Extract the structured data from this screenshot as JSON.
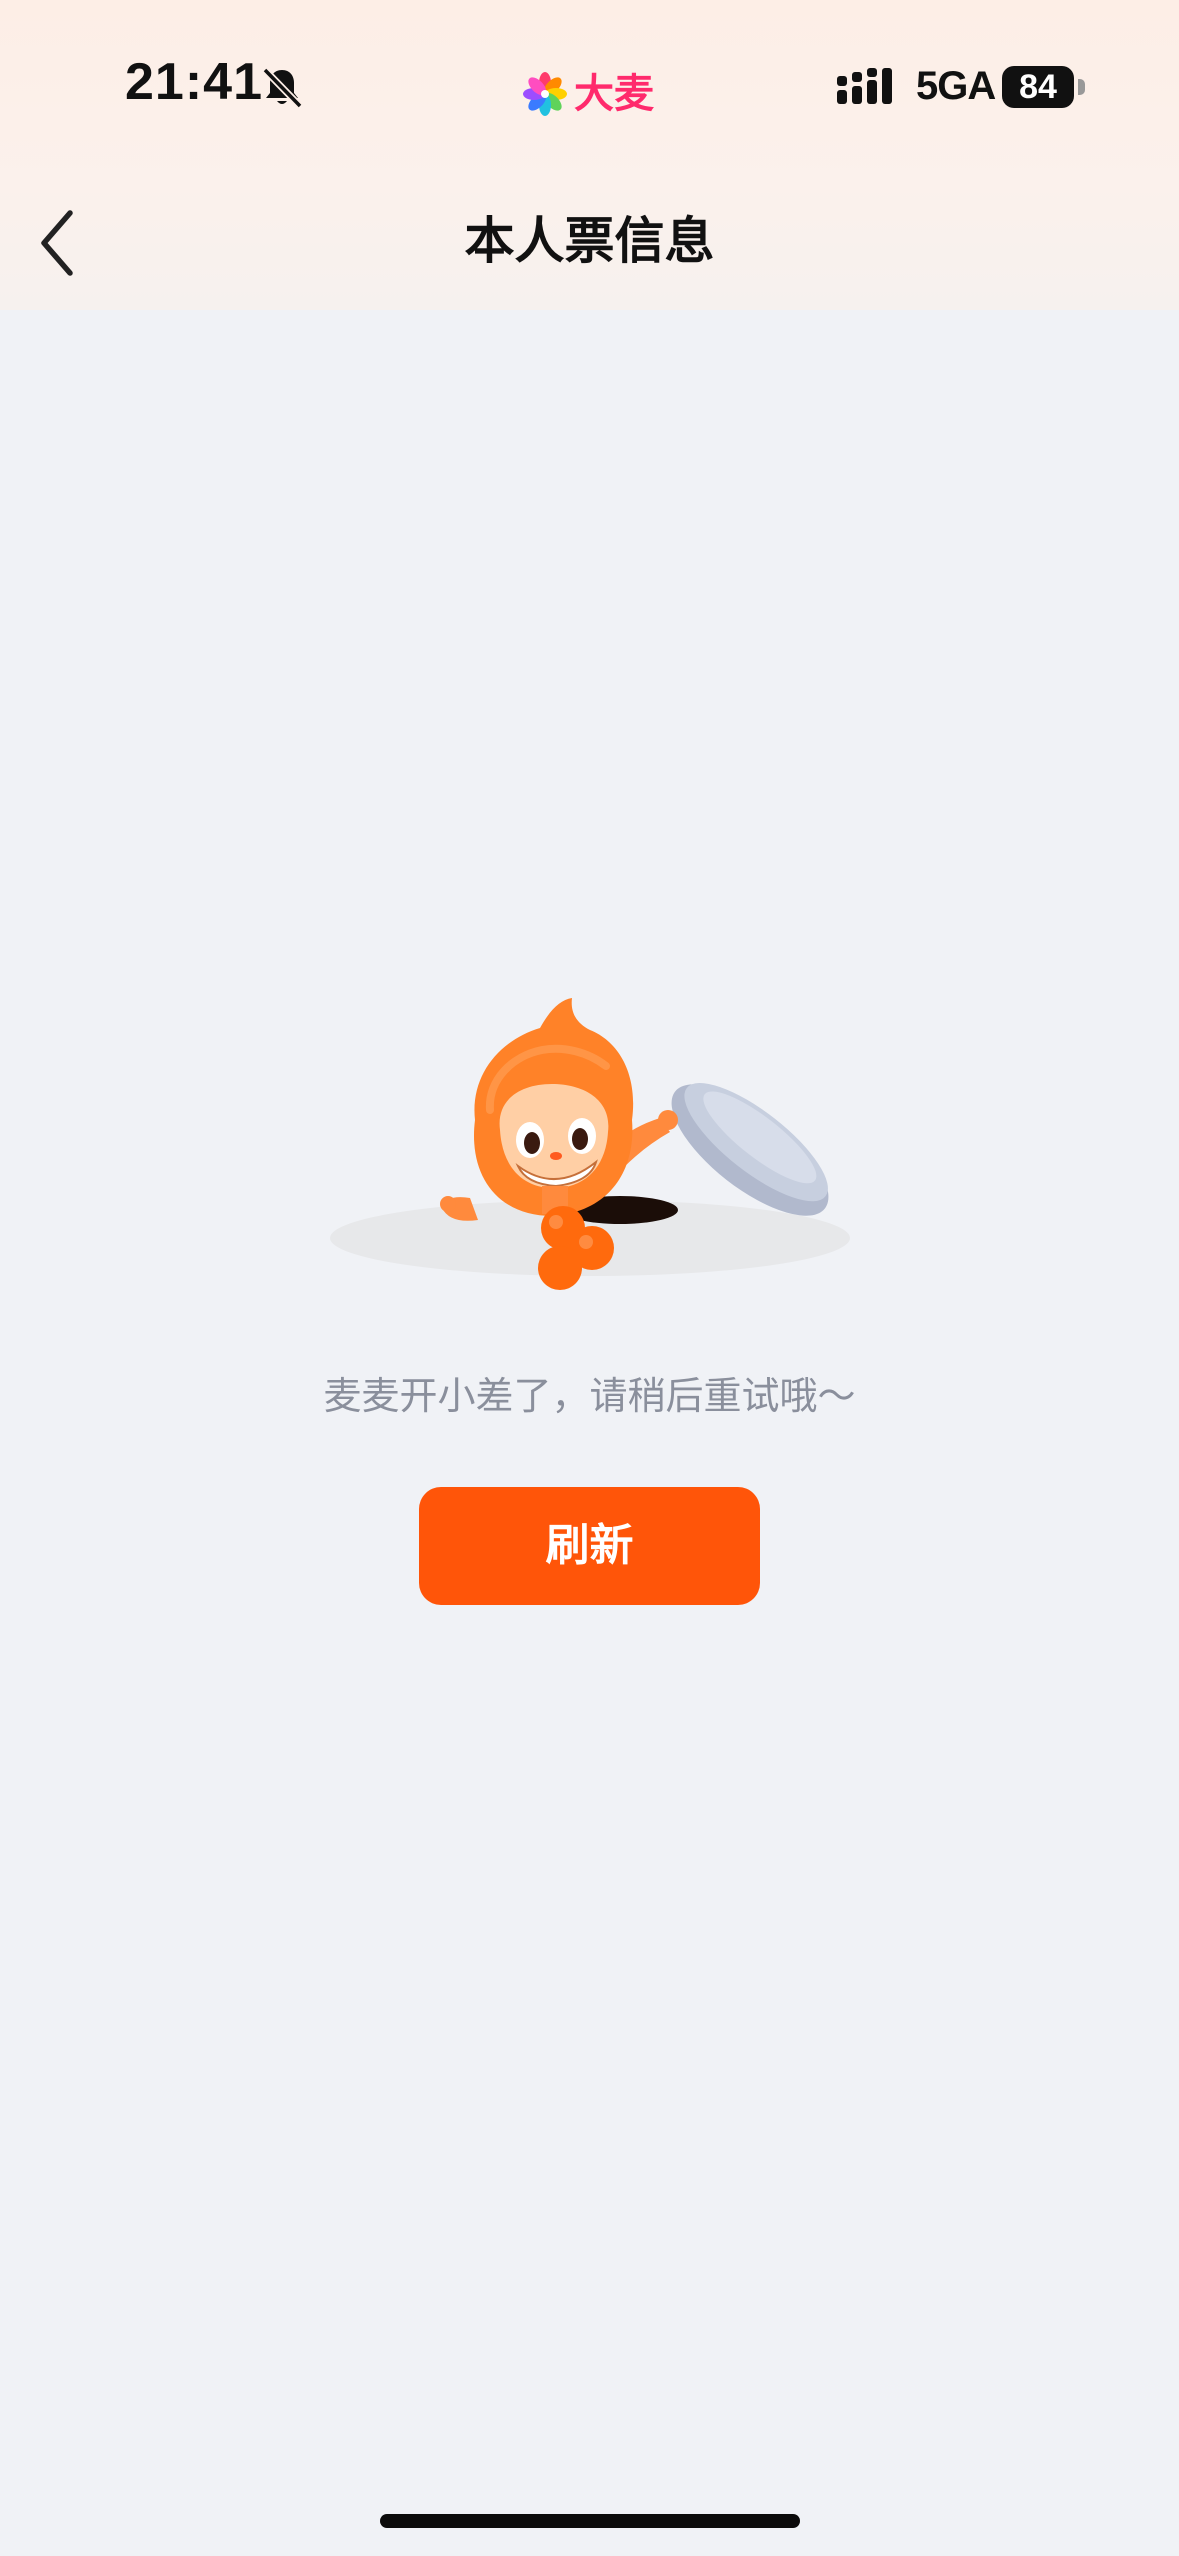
{
  "status_bar": {
    "time": "21:41",
    "network": "5GA",
    "battery": "84",
    "brand": "大麦",
    "icons": [
      "bell-muted-icon",
      "signal-icon",
      "battery-icon"
    ]
  },
  "nav": {
    "title": "本人票信息",
    "back_icon": "chevron-left-icon"
  },
  "empty_state": {
    "message": "麦麦开小差了，请稍后重试哦～",
    "illustration": "mascot-peeking-from-hole",
    "button_label": "刷新"
  },
  "colors": {
    "accent": "#ff5509",
    "brand": "#ff2a6c",
    "background": "#f0f2f6",
    "message_text": "#8a8f9c"
  }
}
